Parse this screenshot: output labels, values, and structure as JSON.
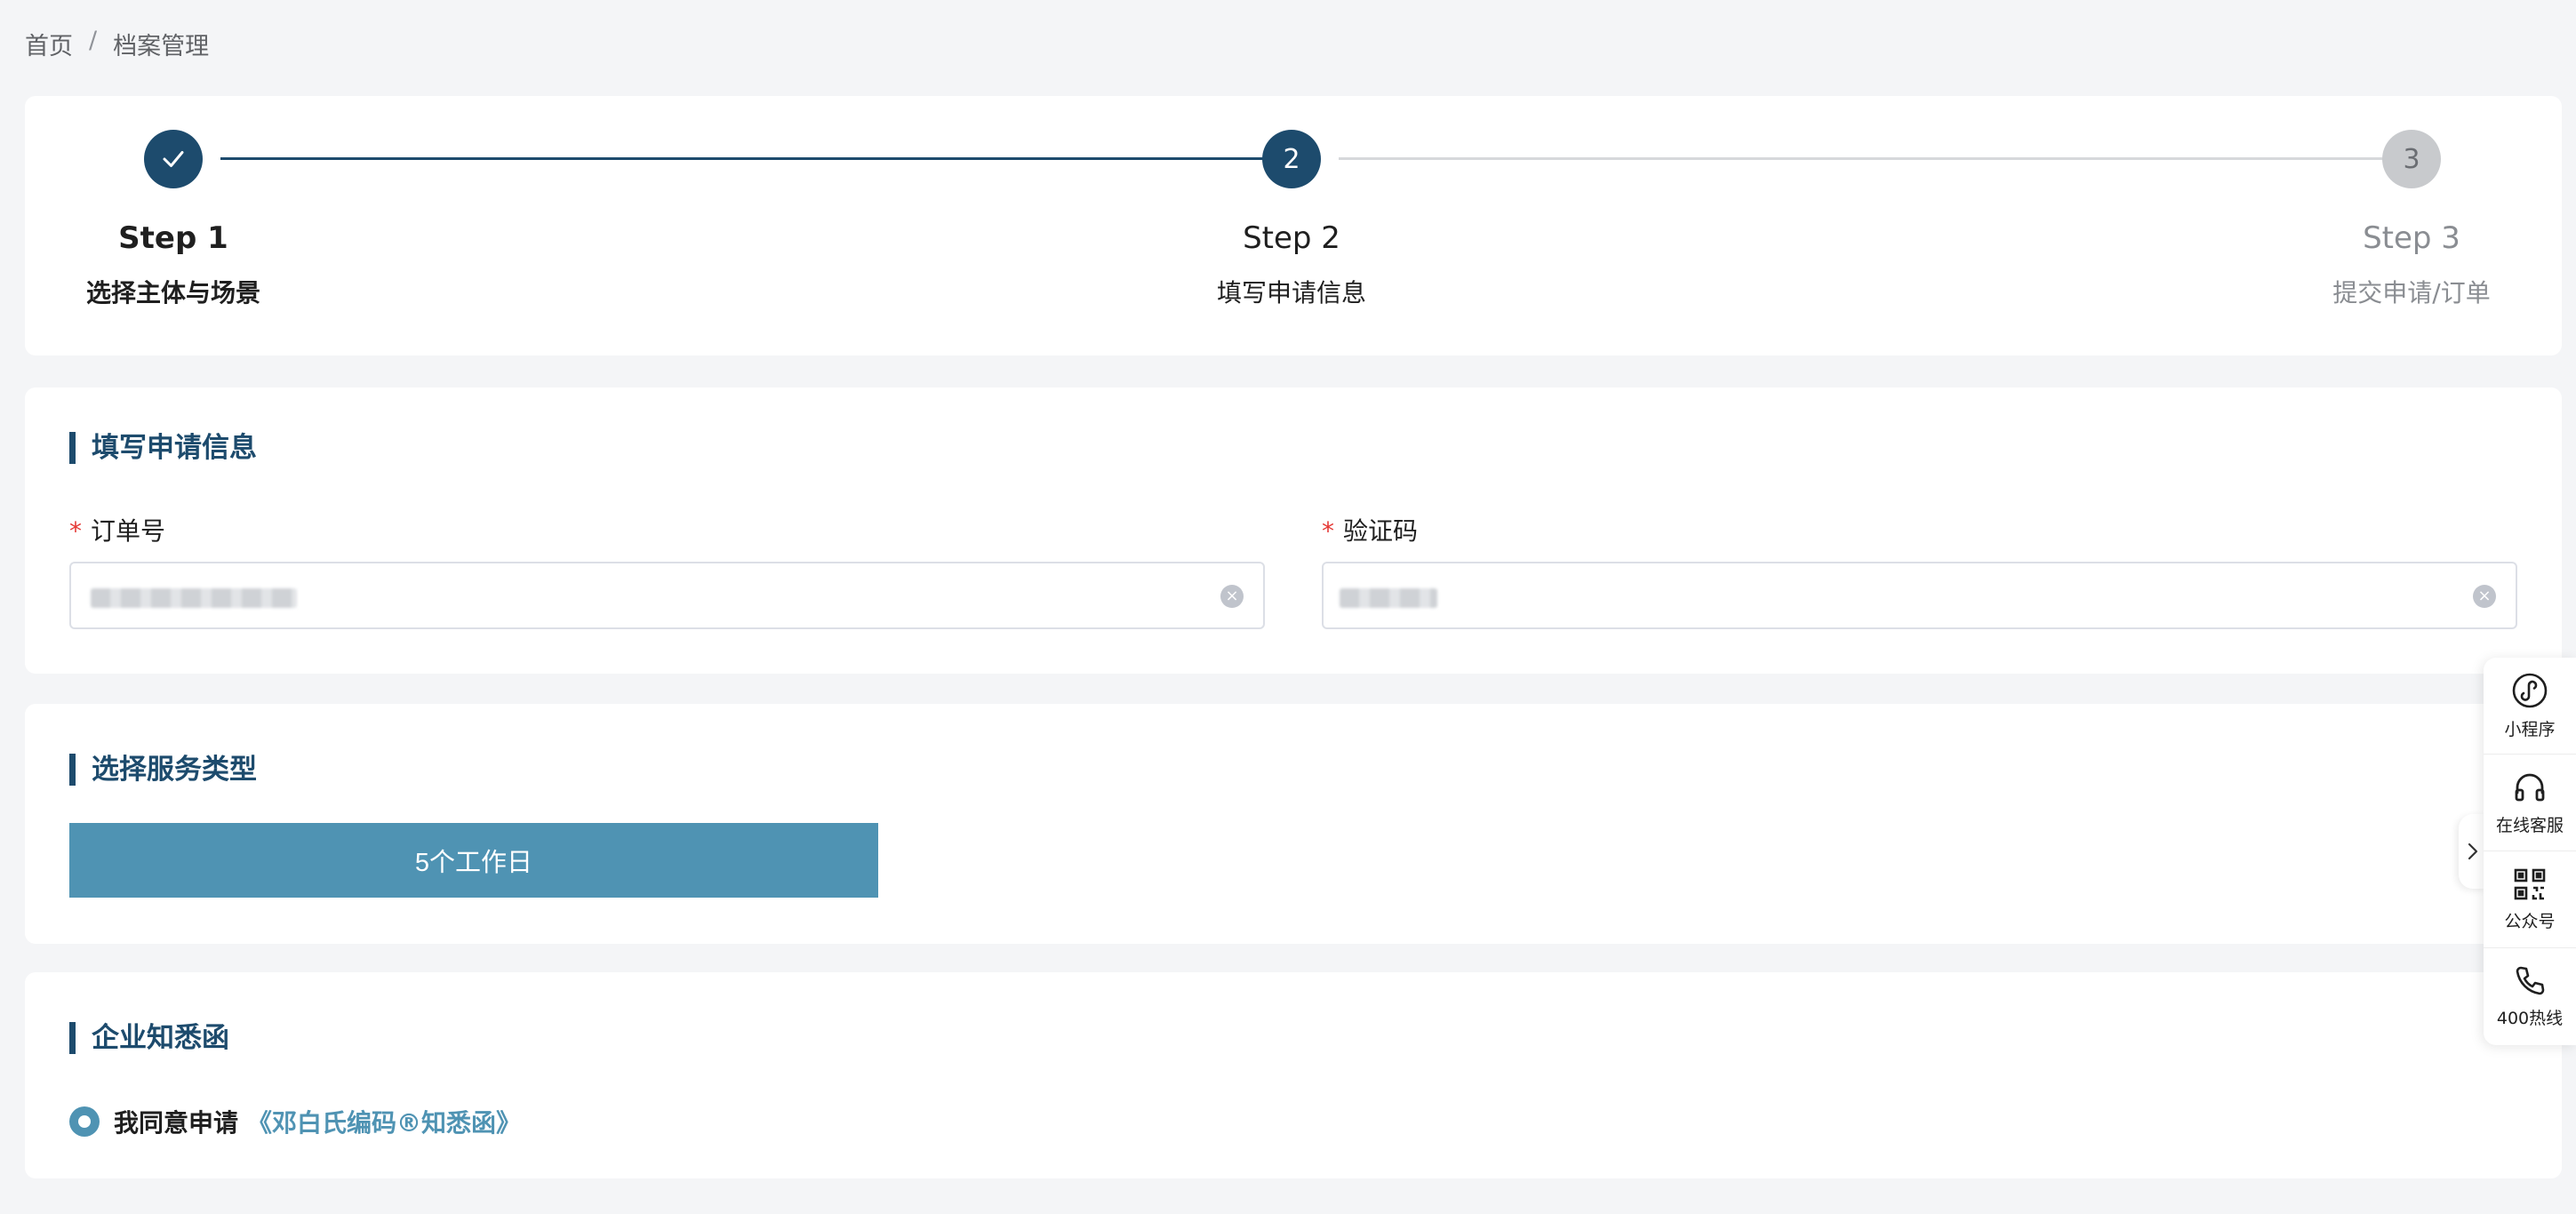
{
  "breadcrumb": {
    "home": "首页",
    "separator": "/",
    "current": "档案管理"
  },
  "steps": [
    {
      "title": "Step 1",
      "desc": "选择主体与场景",
      "status": "done"
    },
    {
      "title": "Step 2",
      "desc": "填写申请信息",
      "status": "active",
      "number": "2"
    },
    {
      "title": "Step 3",
      "desc": "提交申请/订单",
      "status": "pending",
      "number": "3"
    }
  ],
  "info_section": {
    "title": "填写申请信息",
    "order_field": {
      "required_mark": "*",
      "label": "订单号",
      "value": "XXXXXXXXXXXXXXXX"
    },
    "code_field": {
      "required_mark": "*",
      "label": "验证码",
      "value": "XXXXXX"
    }
  },
  "service_section": {
    "title": "选择服务类型",
    "option_label": "5个工作日"
  },
  "notice_section": {
    "title": "企业知悉函",
    "agree_text": "我同意申请",
    "agree_link": "《邓白氏编码®知悉函》"
  },
  "side_toolbar": {
    "items": [
      {
        "label": "小程序",
        "icon": "mini-program-icon"
      },
      {
        "label": "在线客服",
        "icon": "headset-icon"
      },
      {
        "label": "公众号",
        "icon": "qrcode-icon"
      },
      {
        "label": "400热线",
        "icon": "phone-icon"
      }
    ]
  },
  "colors": {
    "primary": "#1d4b6d",
    "accent": "#4f93b3",
    "required": "#e53935",
    "pending": "#c8cacd"
  }
}
